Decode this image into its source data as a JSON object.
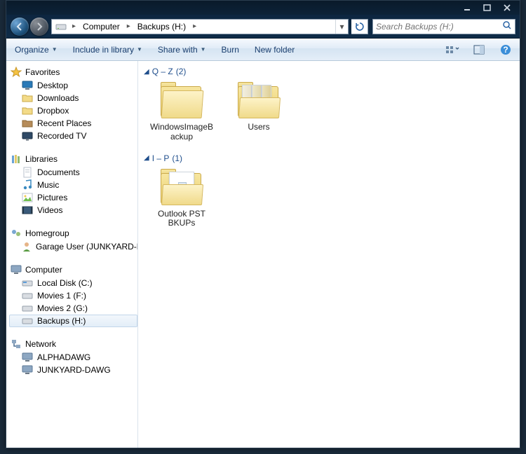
{
  "titlebar": {
    "minimize_label": "Minimize",
    "maximize_label": "Maximize",
    "close_label": "Close"
  },
  "nav": {
    "back_label": "Back",
    "forward_label": "Forward"
  },
  "address": {
    "segments": [
      "Computer",
      "Backups (H:)"
    ],
    "refresh_label": "Refresh"
  },
  "search": {
    "placeholder": "Search Backups (H:)"
  },
  "toolbar": {
    "organize": "Organize",
    "include": "Include in library",
    "share": "Share with",
    "burn": "Burn",
    "newfolder": "New folder",
    "view_label": "Change your view",
    "preview_label": "Show the preview pane",
    "help_label": "Get help"
  },
  "sidebar": {
    "favorites": {
      "label": "Favorites",
      "items": [
        "Desktop",
        "Downloads",
        "Dropbox",
        "Recent Places",
        "Recorded TV"
      ]
    },
    "libraries": {
      "label": "Libraries",
      "items": [
        "Documents",
        "Music",
        "Pictures",
        "Videos"
      ]
    },
    "homegroup": {
      "label": "Homegroup",
      "items": [
        "Garage User (JUNKYARD-DAWG)"
      ]
    },
    "computer": {
      "label": "Computer",
      "items": [
        "Local Disk (C:)",
        "Movies 1 (F:)",
        "Movies 2 (G:)",
        "Backups (H:)"
      ],
      "selected_index": 3
    },
    "network": {
      "label": "Network",
      "items": [
        "ALPHADAWG",
        "JUNKYARD-DAWG"
      ]
    }
  },
  "main": {
    "groups": [
      {
        "name": "Q – Z",
        "count": "(2)",
        "items": [
          {
            "label": "WindowsImageBackup",
            "kind": "folder"
          },
          {
            "label": "Users",
            "kind": "folder-multi"
          }
        ]
      },
      {
        "name": "I – P",
        "count": "(1)",
        "items": [
          {
            "label": "Outlook PST BKUPs",
            "kind": "folder-doc"
          }
        ]
      }
    ]
  }
}
